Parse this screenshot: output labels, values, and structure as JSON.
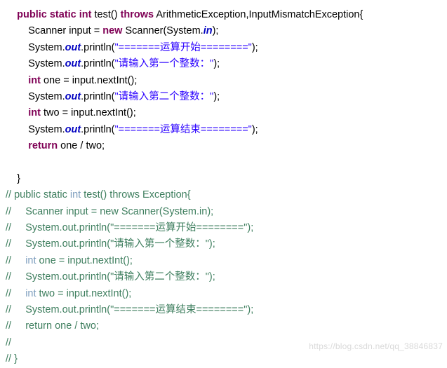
{
  "document": {
    "type": "java-code-snippet",
    "watermark": "https://blog.csdn.net/qq_38846837",
    "colors": {
      "background": "#ffffff",
      "keyword": "#7f0055",
      "string": "#2a00ff",
      "comment": "#3f7f5f",
      "comment_keyword": "#7f9fbf",
      "field": "#0000c0",
      "plain": "#000000",
      "watermark": "#d9d9d9"
    },
    "lines": [
      {
        "id": "line-1",
        "tokens": [
          {
            "text": "    ",
            "style": "plain"
          },
          {
            "text": "public",
            "style": "kw"
          },
          {
            "text": " ",
            "style": "plain"
          },
          {
            "text": "static",
            "style": "kw"
          },
          {
            "text": " ",
            "style": "plain"
          },
          {
            "text": "int",
            "style": "kw"
          },
          {
            "text": " test() ",
            "style": "plain"
          },
          {
            "text": "throws",
            "style": "kw"
          },
          {
            "text": " ArithmeticException,InputMismatchException{",
            "style": "plain"
          }
        ]
      },
      {
        "id": "line-2",
        "tokens": [
          {
            "text": "        Scanner input = ",
            "style": "plain"
          },
          {
            "text": "new",
            "style": "kw"
          },
          {
            "text": " Scanner(System.",
            "style": "plain"
          },
          {
            "text": "in",
            "style": "fld-b"
          },
          {
            "text": ");",
            "style": "plain"
          }
        ]
      },
      {
        "id": "line-3",
        "tokens": [
          {
            "text": "        System.",
            "style": "plain"
          },
          {
            "text": "out",
            "style": "fld-b"
          },
          {
            "text": ".println(",
            "style": "plain"
          },
          {
            "text": "\"=======运算开始========\"",
            "style": "str"
          },
          {
            "text": ");",
            "style": "plain"
          }
        ]
      },
      {
        "id": "line-4",
        "tokens": [
          {
            "text": "        System.",
            "style": "plain"
          },
          {
            "text": "out",
            "style": "fld-b"
          },
          {
            "text": ".println(",
            "style": "plain"
          },
          {
            "text": "\"请输入第一个整数：\"",
            "style": "str"
          },
          {
            "text": ");",
            "style": "plain"
          }
        ]
      },
      {
        "id": "line-5",
        "tokens": [
          {
            "text": "        ",
            "style": "plain"
          },
          {
            "text": "int",
            "style": "kw"
          },
          {
            "text": " one = input.nextInt();",
            "style": "plain"
          }
        ]
      },
      {
        "id": "line-6",
        "tokens": [
          {
            "text": "        System.",
            "style": "plain"
          },
          {
            "text": "out",
            "style": "fld-b"
          },
          {
            "text": ".println(",
            "style": "plain"
          },
          {
            "text": "\"请输入第二个整数：\"",
            "style": "str"
          },
          {
            "text": ");",
            "style": "plain"
          }
        ]
      },
      {
        "id": "line-7",
        "tokens": [
          {
            "text": "        ",
            "style": "plain"
          },
          {
            "text": "int",
            "style": "kw"
          },
          {
            "text": " two = input.nextInt();",
            "style": "plain"
          }
        ]
      },
      {
        "id": "line-8",
        "tokens": [
          {
            "text": "        System.",
            "style": "plain"
          },
          {
            "text": "out",
            "style": "fld-b"
          },
          {
            "text": ".println(",
            "style": "plain"
          },
          {
            "text": "\"=======运算结束========\"",
            "style": "str"
          },
          {
            "text": ");",
            "style": "plain"
          }
        ]
      },
      {
        "id": "line-9",
        "tokens": [
          {
            "text": "        ",
            "style": "plain"
          },
          {
            "text": "return",
            "style": "kw"
          },
          {
            "text": " one / two;",
            "style": "plain"
          }
        ]
      },
      {
        "id": "line-10",
        "tokens": [
          {
            "text": "",
            "style": "plain"
          }
        ]
      },
      {
        "id": "line-11",
        "tokens": [
          {
            "text": "    }",
            "style": "plain"
          }
        ]
      },
      {
        "id": "line-12",
        "tokens": [
          {
            "text": "// public static ",
            "style": "cmt"
          },
          {
            "text": "int",
            "style": "cmt-kw"
          },
          {
            "text": " test() throws Exception{",
            "style": "cmt"
          }
        ]
      },
      {
        "id": "line-13",
        "tokens": [
          {
            "text": "//     Scanner input = new Scanner(System.in);",
            "style": "cmt"
          }
        ]
      },
      {
        "id": "line-14",
        "tokens": [
          {
            "text": "//     System.out.println(\"=======运算开始========\");",
            "style": "cmt"
          }
        ]
      },
      {
        "id": "line-15",
        "tokens": [
          {
            "text": "//     System.out.println(\"请输入第一个整数：\");",
            "style": "cmt"
          }
        ]
      },
      {
        "id": "line-16",
        "tokens": [
          {
            "text": "//     ",
            "style": "cmt"
          },
          {
            "text": "int",
            "style": "cmt-kw"
          },
          {
            "text": " one = input.nextInt();",
            "style": "cmt"
          }
        ]
      },
      {
        "id": "line-17",
        "tokens": [
          {
            "text": "//     System.out.println(\"请输入第二个整数：\");",
            "style": "cmt"
          }
        ]
      },
      {
        "id": "line-18",
        "tokens": [
          {
            "text": "//     ",
            "style": "cmt"
          },
          {
            "text": "int",
            "style": "cmt-kw"
          },
          {
            "text": " two = input.nextInt();",
            "style": "cmt"
          }
        ]
      },
      {
        "id": "line-19",
        "tokens": [
          {
            "text": "//     System.out.println(\"=======运算结束========\");",
            "style": "cmt"
          }
        ]
      },
      {
        "id": "line-20",
        "tokens": [
          {
            "text": "//     return one / two;",
            "style": "cmt"
          }
        ]
      },
      {
        "id": "line-21",
        "tokens": [
          {
            "text": "//",
            "style": "cmt"
          }
        ]
      },
      {
        "id": "line-22",
        "tokens": [
          {
            "text": "// }",
            "style": "cmt"
          }
        ]
      }
    ]
  }
}
